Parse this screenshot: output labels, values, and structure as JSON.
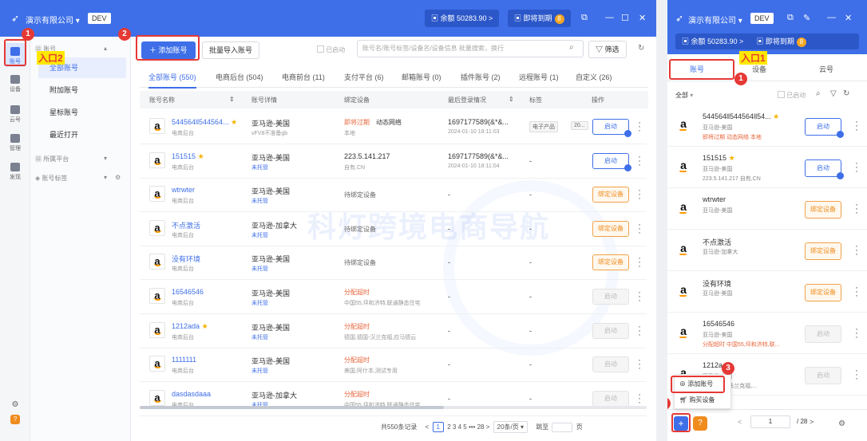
{
  "window_main": {
    "company": "演示有限公司",
    "env": "DEV",
    "balance": "余额 50283.90 >",
    "expire": "即将到期",
    "expire_count": "8",
    "rail": [
      {
        "label": "账号",
        "active": true
      },
      {
        "label": "设备"
      },
      {
        "label": "云号"
      },
      {
        "label": "管理"
      },
      {
        "label": "发现"
      }
    ],
    "nav": {
      "group_account": "账号",
      "items": [
        "全部账号",
        "附加账号",
        "星标账号",
        "最近打开"
      ],
      "group_platform": "所属平台",
      "group_tag": "账号标签"
    },
    "toolbar": {
      "add_label": "添加账号",
      "import_label": "批量导入账号",
      "started_label": "已启动",
      "search_placeholder": "账号名/账号标签/设备名/设备信息 批量搜索，换行",
      "filter_label": "筛选"
    },
    "tabs": [
      "全部账号 (550)",
      "电商后台 (504)",
      "电商前台 (11)",
      "支付平台 (6)",
      "邮箱账号 (0)",
      "插件账号 (2)",
      "远程账号 (1)",
      "自定义 (26)"
    ],
    "columns": [
      "账号名称",
      "账号详情",
      "绑定设备",
      "最后登录情况",
      "标签",
      "操作"
    ],
    "rows": [
      {
        "name": "544564ll544564...",
        "star": "★",
        "sub": "电商后台",
        "detail": "亚马逊-美国",
        "detail_sub": "vFV8不准备gb",
        "device": "即将过期",
        "device2": "动态网络",
        "device_sub": "本地",
        "login": "1697177589(&*&...",
        "login_time": "2024-01-10 18:11:03",
        "tag1": "电子产品",
        "tag2": "20...",
        "action": "启动",
        "atype": "blue"
      },
      {
        "name": "151515",
        "star": "★",
        "sub": "电商后台",
        "detail": "亚马逊-美国",
        "detail_sub": "未托管",
        "device": "223.5.141.217",
        "device_sub": "自有,CN",
        "login": "1697177589(&*&...",
        "login_time": "2024-01-10 18:11:04",
        "tag1": "-",
        "action": "启动",
        "atype": "blue"
      },
      {
        "name": "wtrwter",
        "sub": "电商后台",
        "detail": "亚马逊-美国",
        "detail_sub": "未托管",
        "device": "待绑定设备",
        "login": "-",
        "tag1": "-",
        "action": "绑定设备",
        "atype": "orange"
      },
      {
        "name": "不点激活",
        "sub": "电商后台",
        "detail": "亚马逊-加拿大",
        "detail_sub": "未托管",
        "device": "待绑定设备",
        "login": "-",
        "tag1": "-",
        "action": "绑定设备",
        "atype": "orange"
      },
      {
        "name": "没有环境",
        "sub": "电商后台",
        "detail": "亚马逊-美国",
        "detail_sub": "未托管",
        "device": "待绑定设备",
        "login": "-",
        "tag1": "-",
        "action": "绑定设备",
        "atype": "orange"
      },
      {
        "name": "16546546",
        "sub": "电商后台",
        "detail": "亚马逊-美国",
        "detail_sub": "未托管",
        "device": "分配超时",
        "device_sub": "中国55,坪和济特,联通静态住宅",
        "login": "-",
        "tag1": "-",
        "action": "启动",
        "atype": "gray"
      },
      {
        "name": "1212ada",
        "star": "★",
        "sub": "电商后台",
        "detail": "亚马逊-美国",
        "detail_sub": "未托管",
        "device": "分配超时",
        "device_sub": "德国,德国-汉兰克福,应马德云",
        "login": "-",
        "tag1": "-",
        "action": "启动",
        "atype": "gray"
      },
      {
        "name": "1111111",
        "sub": "电商后台",
        "detail": "亚马逊-美国",
        "detail_sub": "未托管",
        "device": "分配超时",
        "device_sub": "美国,阿什本,测试专用",
        "login": "-",
        "tag1": "-",
        "action": "启动",
        "atype": "gray"
      },
      {
        "name": "dasdasdaaa",
        "sub": "电商后台",
        "detail": "亚马逊-加拿大",
        "detail_sub": "未托管",
        "device": "分配超时",
        "device_sub": "中国55,坪和济特,联通静态住宅",
        "login": "-",
        "tag1": "-",
        "action": "启动",
        "atype": "gray"
      }
    ],
    "pager": {
      "total": "共550条记录",
      "pages": [
        "<",
        "1",
        "2",
        "3",
        "4",
        "5",
        "•••",
        "28",
        ">"
      ],
      "per_page": "20条/页",
      "jump_label": "跳至",
      "page_suffix": "页"
    },
    "watermark": "科灯跨境电商导航"
  },
  "annotations": {
    "entry2": "入口2",
    "entry1": "入口1",
    "n1": "1",
    "n2": "2",
    "n3": "3"
  },
  "window_side": {
    "company": "演示有限公司",
    "env": "DEV",
    "balance": "余额 50283.90 >",
    "expire": "即将到期",
    "expire_count": "8",
    "tabs": [
      "账号",
      "设备",
      "云号"
    ],
    "filter_all": "全部",
    "started_label": "已启动",
    "items": [
      {
        "name": "544564ll544564ll54...",
        "star": "★",
        "sub1": "亚马逊-美国",
        "sub2": "即将过期  动态网络  本地",
        "action": "启动",
        "atype": "blue"
      },
      {
        "name": "151515",
        "star": "★",
        "sub1": "亚马逊-美国",
        "sub2": "223.5.141.217  自有,CN",
        "action": "启动",
        "atype": "blue"
      },
      {
        "name": "wtrwter",
        "sub1": "亚马逊-美国",
        "sub2": "",
        "action": "绑定设备",
        "atype": "orange"
      },
      {
        "name": "不点激活",
        "sub1": "亚马逊-加拿大",
        "sub2": "",
        "action": "绑定设备",
        "atype": "orange"
      },
      {
        "name": "没有环境",
        "sub1": "亚马逊-美国",
        "sub2": "",
        "action": "绑定设备",
        "atype": "orange"
      },
      {
        "name": "16546546",
        "sub1": "亚马逊-美国",
        "sub2": "分配超时  中国55,坪和济特,联...",
        "action": "启动",
        "atype": "gray"
      },
      {
        "name": "1212a",
        "sub1": "亚马逊-美国",
        "sub2": "德国,德国-法兰克福,...",
        "action": "启动",
        "atype": "gray"
      }
    ],
    "menu": [
      "添加账号",
      "购买设备"
    ],
    "page_value": "1",
    "page_total": "/ 28"
  }
}
